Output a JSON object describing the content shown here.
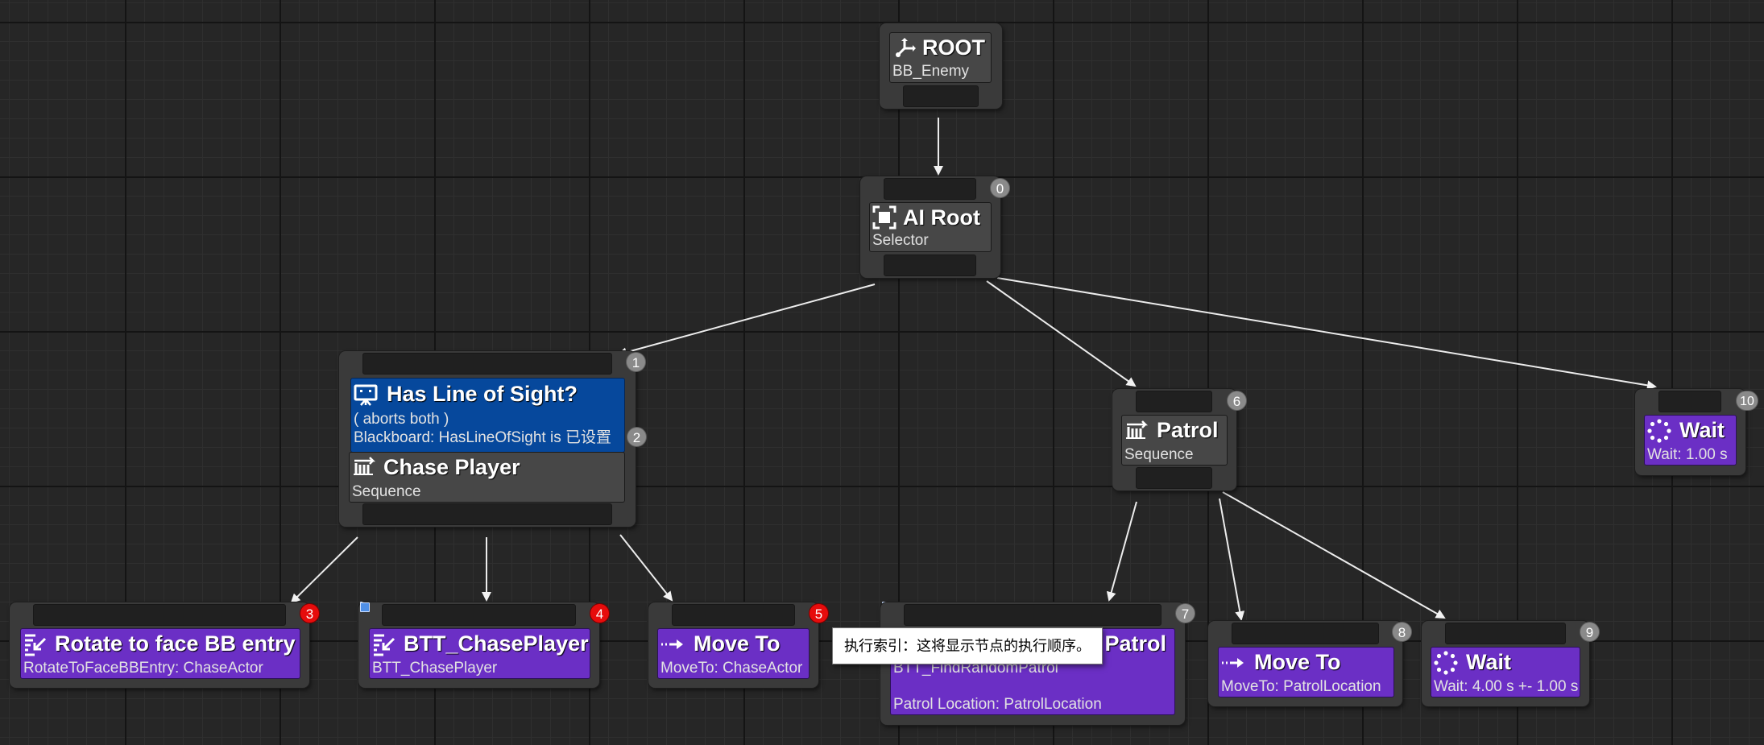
{
  "nodes": {
    "root": {
      "title": "ROOT",
      "subtitle": "BB_Enemy",
      "icon": "root-branch-icon"
    },
    "ai_root": {
      "title": "AI Root",
      "subtitle": "Selector",
      "index": "0",
      "icon": "selector-icon"
    },
    "has_los": {
      "title": "Has Line of Sight?",
      "line1": "( aborts both )",
      "line2": "Blackboard: HasLineOfSight is 已设置",
      "index": "2",
      "icon": "monitor-icon"
    },
    "chase_player": {
      "title": "Chase Player",
      "subtitle": "Sequence",
      "index": "1",
      "icon": "sequence-icon"
    },
    "rotate": {
      "title": "Rotate to face BB entry",
      "subtitle": "RotateToFaceBBEntry: ChaseActor",
      "index": "3",
      "icon": "rotate-task-icon"
    },
    "btt_chase": {
      "title": "BTT_ChasePlayer",
      "subtitle": "BTT_ChasePlayer",
      "index": "4",
      "icon": "task-icon"
    },
    "move_to_chase": {
      "title": "Move To",
      "subtitle": "MoveTo: ChaseActor",
      "index": "5",
      "icon": "move-arrow-icon"
    },
    "find_patrol": {
      "title_visible": "Patrol",
      "line1": "BTT_FindRandomPatrol",
      "line2": "Patrol Location: PatrolLocation",
      "index": "7",
      "icon": "task-icon"
    },
    "patrol": {
      "title": "Patrol",
      "subtitle": "Sequence",
      "index": "6",
      "icon": "sequence-icon"
    },
    "move_to_patrol": {
      "title": "Move To",
      "subtitle": "MoveTo: PatrolLocation",
      "index": "8",
      "icon": "move-arrow-icon"
    },
    "wait_patrol": {
      "title": "Wait",
      "subtitle": "Wait: 4.00 s +- 1.00 s",
      "index": "9",
      "icon": "wait-dots-icon"
    },
    "wait_end": {
      "title": "Wait",
      "subtitle": "Wait: 1.00 s",
      "index": "10",
      "icon": "wait-dots-icon"
    }
  },
  "tooltip": {
    "text": "执行索引：这将显示节点的执行顺序。"
  },
  "colors": {
    "canvas": "#262626",
    "node_frame": "#3a3a3a",
    "composite": "#474747",
    "task": "#6b2fc5",
    "decorator": "#06489c",
    "badge": "#8a8a8a",
    "badge_alert": "#e60c0c"
  }
}
